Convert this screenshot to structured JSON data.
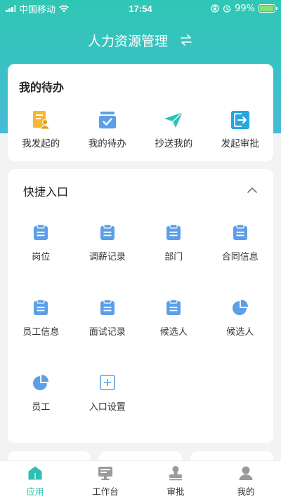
{
  "status_bar": {
    "carrier": "中国移动",
    "time": "17:54",
    "battery": "99%"
  },
  "header": {
    "title": "人力资源管理"
  },
  "todo": {
    "title": "我的待办",
    "items": [
      {
        "label": "我发起的"
      },
      {
        "label": "我的待办"
      },
      {
        "label": "抄送我的"
      },
      {
        "label": "发起审批"
      }
    ]
  },
  "quick": {
    "title": "快捷入口",
    "items": [
      {
        "label": "岗位"
      },
      {
        "label": "调薪记录"
      },
      {
        "label": "部门"
      },
      {
        "label": "合同信息"
      },
      {
        "label": "员工信息"
      },
      {
        "label": "面试记录"
      },
      {
        "label": "候选人"
      },
      {
        "label": "候选人"
      },
      {
        "label": "员工"
      },
      {
        "label": "入口设置"
      }
    ]
  },
  "tabbar": {
    "items": [
      {
        "label": "应用",
        "active": true
      },
      {
        "label": "工作台"
      },
      {
        "label": "审批"
      },
      {
        "label": "我的"
      }
    ]
  },
  "colors": {
    "accent": "#2fbfb2",
    "icon_blue": "#5b9fe8"
  }
}
